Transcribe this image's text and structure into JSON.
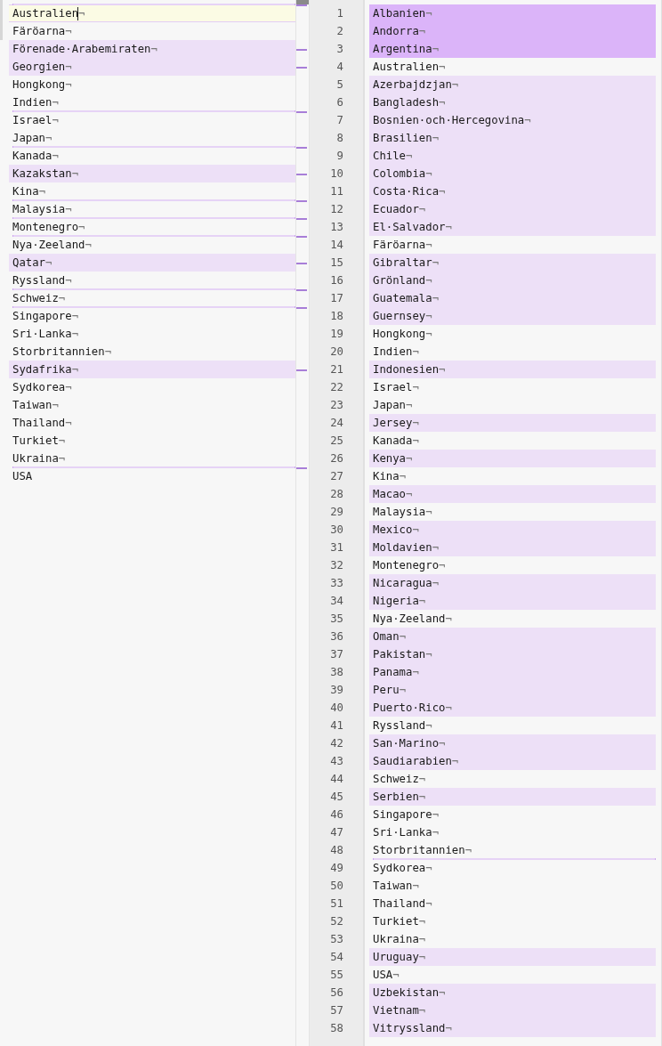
{
  "eol_mark": "¬",
  "left": {
    "rows": [
      {
        "text": "Australien",
        "changed": false,
        "current": true,
        "gap_before": true,
        "eol": true
      },
      {
        "text": "Färöarna",
        "changed": false,
        "current": false,
        "gap_before": false,
        "eol": true
      },
      {
        "text": "Förenade·Arabemiraten",
        "changed": true,
        "current": false,
        "gap_before": false,
        "eol": true
      },
      {
        "text": "Georgien",
        "changed": true,
        "current": false,
        "gap_before": false,
        "eol": true
      },
      {
        "text": "Hongkong",
        "changed": false,
        "current": false,
        "gap_before": false,
        "eol": true
      },
      {
        "text": "Indien",
        "changed": false,
        "current": false,
        "gap_before": false,
        "eol": true
      },
      {
        "text": "Israel",
        "changed": false,
        "current": false,
        "gap_before": true,
        "eol": true
      },
      {
        "text": "Japan",
        "changed": false,
        "current": false,
        "gap_before": false,
        "eol": true
      },
      {
        "text": "Kanada",
        "changed": false,
        "current": false,
        "gap_before": true,
        "eol": true
      },
      {
        "text": "Kazakstan",
        "changed": true,
        "current": false,
        "gap_before": false,
        "eol": true
      },
      {
        "text": "Kina",
        "changed": false,
        "current": false,
        "gap_before": false,
        "eol": true
      },
      {
        "text": "Malaysia",
        "changed": false,
        "current": false,
        "gap_before": true,
        "eol": true
      },
      {
        "text": "Montenegro",
        "changed": false,
        "current": false,
        "gap_before": true,
        "eol": true
      },
      {
        "text": "Nya·Zeeland",
        "changed": false,
        "current": false,
        "gap_before": true,
        "eol": true
      },
      {
        "text": "Qatar",
        "changed": true,
        "current": false,
        "gap_before": false,
        "eol": true
      },
      {
        "text": "Ryssland",
        "changed": false,
        "current": false,
        "gap_before": false,
        "eol": true
      },
      {
        "text": "Schweiz",
        "changed": false,
        "current": false,
        "gap_before": true,
        "eol": true
      },
      {
        "text": "Singapore",
        "changed": false,
        "current": false,
        "gap_before": true,
        "eol": true
      },
      {
        "text": "Sri·Lanka",
        "changed": false,
        "current": false,
        "gap_before": false,
        "eol": true
      },
      {
        "text": "Storbritannien",
        "changed": false,
        "current": false,
        "gap_before": false,
        "eol": true
      },
      {
        "text": "Sydafrika",
        "changed": true,
        "current": false,
        "gap_before": false,
        "eol": true
      },
      {
        "text": "Sydkorea",
        "changed": false,
        "current": false,
        "gap_before": false,
        "eol": true
      },
      {
        "text": "Taiwan",
        "changed": false,
        "current": false,
        "gap_before": false,
        "eol": true
      },
      {
        "text": "Thailand",
        "changed": false,
        "current": false,
        "gap_before": false,
        "eol": true
      },
      {
        "text": "Turkiet",
        "changed": false,
        "current": false,
        "gap_before": false,
        "eol": true
      },
      {
        "text": "Ukraina",
        "changed": false,
        "current": false,
        "gap_before": false,
        "eol": true
      },
      {
        "text": "USA",
        "changed": false,
        "current": false,
        "gap_before": true,
        "eol": false
      }
    ]
  },
  "right": {
    "rows": [
      {
        "number": "1",
        "text": "Albanien",
        "changed": true,
        "selected": true,
        "gap_before": false
      },
      {
        "number": "2",
        "text": "Andorra",
        "changed": true,
        "selected": true,
        "gap_before": false
      },
      {
        "number": "3",
        "text": "Argentina",
        "changed": true,
        "selected": true,
        "gap_before": false
      },
      {
        "number": "4",
        "text": "Australien",
        "changed": false,
        "selected": false,
        "gap_before": false
      },
      {
        "number": "5",
        "text": "Azerbajdzjan",
        "changed": true,
        "selected": false,
        "gap_before": false
      },
      {
        "number": "6",
        "text": "Bangladesh",
        "changed": true,
        "selected": false,
        "gap_before": false
      },
      {
        "number": "7",
        "text": "Bosnien·och·Hercegovina",
        "changed": true,
        "selected": false,
        "gap_before": false
      },
      {
        "number": "8",
        "text": "Brasilien",
        "changed": true,
        "selected": false,
        "gap_before": false
      },
      {
        "number": "9",
        "text": "Chile",
        "changed": true,
        "selected": false,
        "gap_before": false
      },
      {
        "number": "10",
        "text": "Colombia",
        "changed": true,
        "selected": false,
        "gap_before": false
      },
      {
        "number": "11",
        "text": "Costa·Rica",
        "changed": true,
        "selected": false,
        "gap_before": false
      },
      {
        "number": "12",
        "text": "Ecuador",
        "changed": true,
        "selected": false,
        "gap_before": false
      },
      {
        "number": "13",
        "text": "El·Salvador",
        "changed": true,
        "selected": false,
        "gap_before": false
      },
      {
        "number": "14",
        "text": "Färöarna",
        "changed": false,
        "selected": false,
        "gap_before": false
      },
      {
        "number": "15",
        "text": "Gibraltar",
        "changed": true,
        "selected": false,
        "gap_before": false
      },
      {
        "number": "16",
        "text": "Grönland",
        "changed": true,
        "selected": false,
        "gap_before": false
      },
      {
        "number": "17",
        "text": "Guatemala",
        "changed": true,
        "selected": false,
        "gap_before": false
      },
      {
        "number": "18",
        "text": "Guernsey",
        "changed": true,
        "selected": false,
        "gap_before": false
      },
      {
        "number": "19",
        "text": "Hongkong",
        "changed": false,
        "selected": false,
        "gap_before": false
      },
      {
        "number": "20",
        "text": "Indien",
        "changed": false,
        "selected": false,
        "gap_before": false
      },
      {
        "number": "21",
        "text": "Indonesien",
        "changed": true,
        "selected": false,
        "gap_before": false
      },
      {
        "number": "22",
        "text": "Israel",
        "changed": false,
        "selected": false,
        "gap_before": false
      },
      {
        "number": "23",
        "text": "Japan",
        "changed": false,
        "selected": false,
        "gap_before": false
      },
      {
        "number": "24",
        "text": "Jersey",
        "changed": true,
        "selected": false,
        "gap_before": false
      },
      {
        "number": "25",
        "text": "Kanada",
        "changed": false,
        "selected": false,
        "gap_before": false
      },
      {
        "number": "26",
        "text": "Kenya",
        "changed": true,
        "selected": false,
        "gap_before": false
      },
      {
        "number": "27",
        "text": "Kina",
        "changed": false,
        "selected": false,
        "gap_before": false
      },
      {
        "number": "28",
        "text": "Macao",
        "changed": true,
        "selected": false,
        "gap_before": false
      },
      {
        "number": "29",
        "text": "Malaysia",
        "changed": false,
        "selected": false,
        "gap_before": false
      },
      {
        "number": "30",
        "text": "Mexico",
        "changed": true,
        "selected": false,
        "gap_before": false
      },
      {
        "number": "31",
        "text": "Moldavien",
        "changed": true,
        "selected": false,
        "gap_before": false
      },
      {
        "number": "32",
        "text": "Montenegro",
        "changed": false,
        "selected": false,
        "gap_before": false
      },
      {
        "number": "33",
        "text": "Nicaragua",
        "changed": true,
        "selected": false,
        "gap_before": false
      },
      {
        "number": "34",
        "text": "Nigeria",
        "changed": true,
        "selected": false,
        "gap_before": false
      },
      {
        "number": "35",
        "text": "Nya·Zeeland",
        "changed": false,
        "selected": false,
        "gap_before": false
      },
      {
        "number": "36",
        "text": "Oman",
        "changed": true,
        "selected": false,
        "gap_before": false
      },
      {
        "number": "37",
        "text": "Pakistan",
        "changed": true,
        "selected": false,
        "gap_before": false
      },
      {
        "number": "38",
        "text": "Panama",
        "changed": true,
        "selected": false,
        "gap_before": false
      },
      {
        "number": "39",
        "text": "Peru",
        "changed": true,
        "selected": false,
        "gap_before": false
      },
      {
        "number": "40",
        "text": "Puerto·Rico",
        "changed": true,
        "selected": false,
        "gap_before": false
      },
      {
        "number": "41",
        "text": "Ryssland",
        "changed": false,
        "selected": false,
        "gap_before": false
      },
      {
        "number": "42",
        "text": "San·Marino",
        "changed": true,
        "selected": false,
        "gap_before": false
      },
      {
        "number": "43",
        "text": "Saudiarabien",
        "changed": true,
        "selected": false,
        "gap_before": false
      },
      {
        "number": "44",
        "text": "Schweiz",
        "changed": false,
        "selected": false,
        "gap_before": false
      },
      {
        "number": "45",
        "text": "Serbien",
        "changed": true,
        "selected": false,
        "gap_before": false
      },
      {
        "number": "46",
        "text": "Singapore",
        "changed": false,
        "selected": false,
        "gap_before": false
      },
      {
        "number": "47",
        "text": "Sri·Lanka",
        "changed": false,
        "selected": false,
        "gap_before": false
      },
      {
        "number": "48",
        "text": "Storbritannien",
        "changed": false,
        "selected": false,
        "gap_before": false
      },
      {
        "number": "49",
        "text": "Sydkorea",
        "changed": false,
        "selected": false,
        "gap_before": true
      },
      {
        "number": "50",
        "text": "Taiwan",
        "changed": false,
        "selected": false,
        "gap_before": false
      },
      {
        "number": "51",
        "text": "Thailand",
        "changed": false,
        "selected": false,
        "gap_before": false
      },
      {
        "number": "52",
        "text": "Turkiet",
        "changed": false,
        "selected": false,
        "gap_before": false
      },
      {
        "number": "53",
        "text": "Ukraina",
        "changed": false,
        "selected": false,
        "gap_before": false
      },
      {
        "number": "54",
        "text": "Uruguay",
        "changed": true,
        "selected": false,
        "gap_before": false
      },
      {
        "number": "55",
        "text": "USA",
        "changed": false,
        "selected": false,
        "gap_before": false
      },
      {
        "number": "56",
        "text": "Uzbekistan",
        "changed": true,
        "selected": false,
        "gap_before": false
      },
      {
        "number": "57",
        "text": "Vietnam",
        "changed": true,
        "selected": false,
        "gap_before": false
      },
      {
        "number": "58",
        "text": "Vitryssland",
        "changed": true,
        "selected": false,
        "gap_before": false
      }
    ]
  }
}
